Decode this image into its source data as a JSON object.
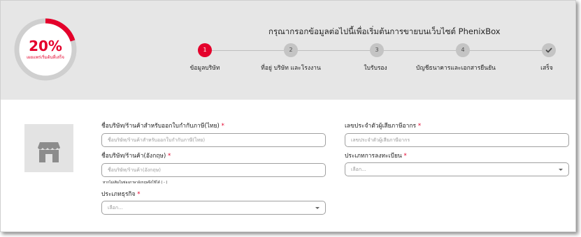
{
  "progress": {
    "value": 20,
    "label": "20%",
    "sub_label": "เผยแพร่เริ่มต้นที่เสร็จ"
  },
  "header": {
    "title": "กรุณากรอกข้อมูลต่อไปนี้เพื่อเริ่มต้นการขายบนเว็บไซต์ PhenixBox"
  },
  "steps": [
    {
      "num": "1",
      "label": "ข้อมูลบริษัท",
      "active": true
    },
    {
      "num": "2",
      "label": "ที่อยู่ บริษัท และโรงงาน",
      "active": false
    },
    {
      "num": "3",
      "label": "ใบรับรอง",
      "active": false
    },
    {
      "num": "4",
      "label": "บัญชีธนาคารและเอกสารยืนยัน",
      "active": false
    },
    {
      "label": "เสร็จ",
      "icon": "check-icon",
      "active": false
    }
  ],
  "form": {
    "company_name_th": {
      "label": "ชื่อบริษัท/ร้านค้าสำหรับออกใบกำกับภาษี(ไทย)",
      "required": "*",
      "placeholder": "ชื่อบริษัท/ร้านค้าสำหรับออกใบกำกับภาษี(ไทย)",
      "value": ""
    },
    "company_name_en": {
      "label": "ชื่อบริษัท/ร้านค้า(อังกฤษ)",
      "required": "*",
      "placeholder": "ชื่อบริษัท/ร้านค้า(อังกฤษ)",
      "value": "",
      "hint": "หากไม่เติมในช่องภาษาอังกฤษจึงใช้ได้ ( - )"
    },
    "business_type": {
      "label": "ประเภทธุรกิจ",
      "required": "*",
      "selected": "เลือก..."
    },
    "tax_id": {
      "label": "เลขประจำตัวผู้เสียภาษีอากร",
      "required": "*",
      "placeholder": "เลขประจำตัวผู้เสียภาษีอากร",
      "value": ""
    },
    "registration_type": {
      "label": "ประเภทการลงทะเบียน",
      "required": "*",
      "selected": "เลือก..."
    }
  },
  "icons": {
    "avatar": "store-icon"
  },
  "colors": {
    "accent": "#e4002b",
    "header_bg": "#e6e6e6",
    "step_inactive": "#c4c4c4",
    "avatar_bg": "#e3e3e3",
    "avatar_icon": "#8c8c8c"
  }
}
